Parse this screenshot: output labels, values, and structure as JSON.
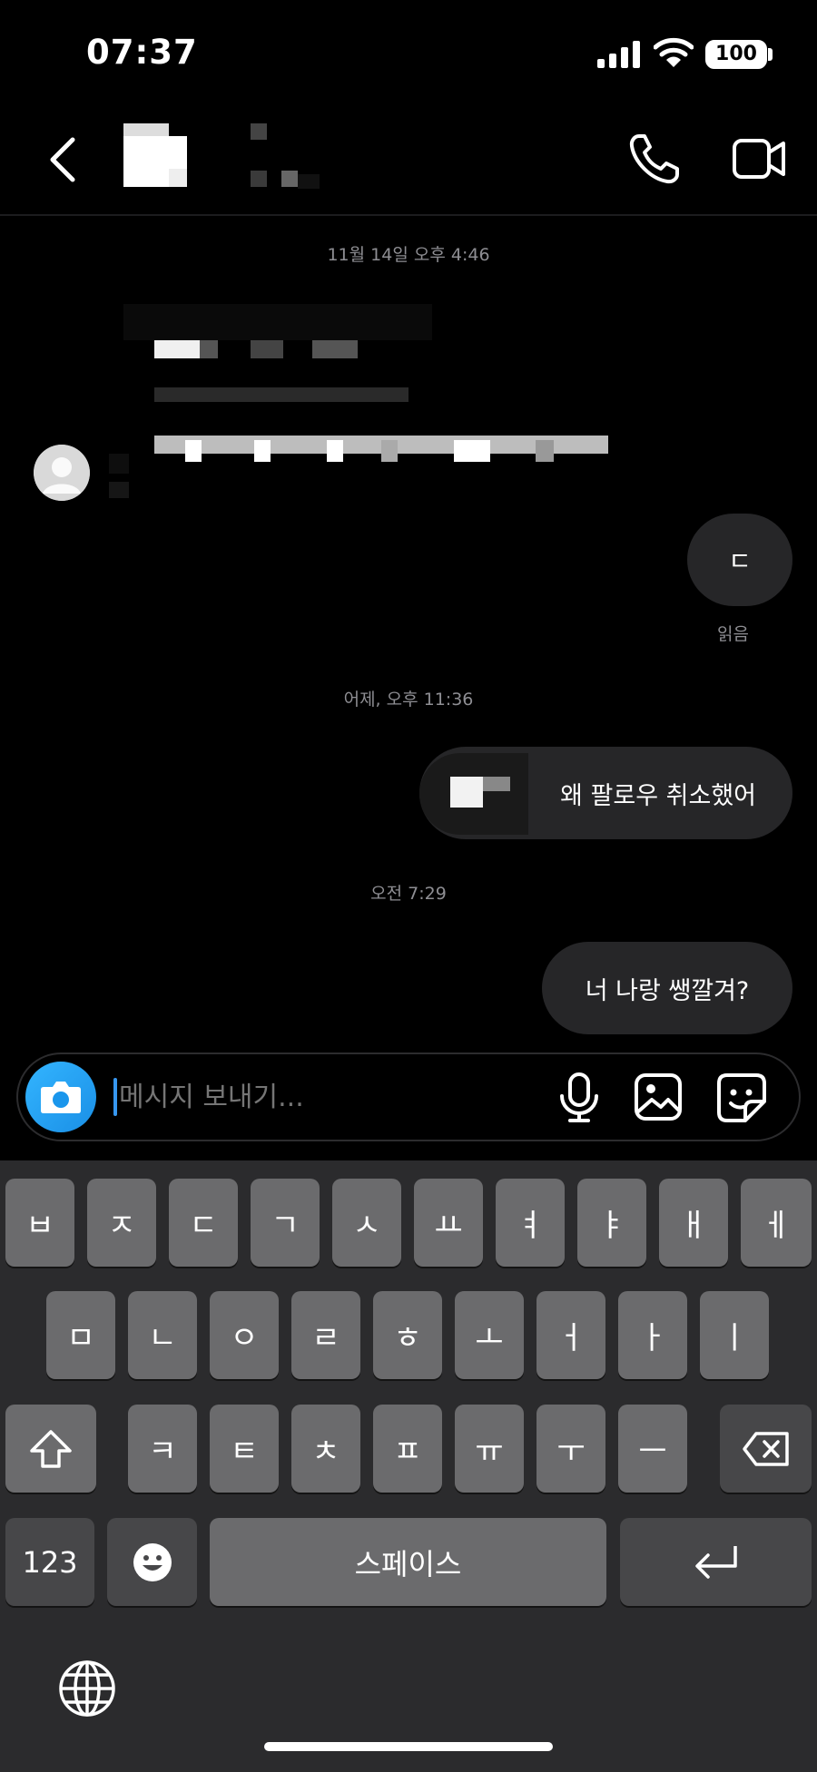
{
  "status_bar": {
    "time": "07:37",
    "battery": "100"
  },
  "timestamps": [
    "11월 14일 오후 4:46",
    "어제, 오후 11:36",
    "오전 7:29"
  ],
  "messages": {
    "outgoing_1": "ㄷ",
    "read_receipt": "읽음",
    "outgoing_2": "왜 팔로우 취소했어",
    "outgoing_3": "너 나랑 쌩깔겨?"
  },
  "composer": {
    "placeholder": "메시지 보내기..."
  },
  "keyboard": {
    "row1": [
      "ㅂ",
      "ㅈ",
      "ㄷ",
      "ㄱ",
      "ㅅ",
      "ㅛ",
      "ㅕ",
      "ㅑ",
      "ㅐ",
      "ㅔ"
    ],
    "row2": [
      "ㅁ",
      "ㄴ",
      "ㅇ",
      "ㄹ",
      "ㅎ",
      "ㅗ",
      "ㅓ",
      "ㅏ",
      "ㅣ"
    ],
    "row3": [
      "ㅋ",
      "ㅌ",
      "ㅊ",
      "ㅍ",
      "ㅠ",
      "ㅜ",
      "ㅡ"
    ],
    "numbers": "123",
    "space": "스페이스"
  },
  "colors": {
    "accent": "#3797f0",
    "bubble": "#262628",
    "background": "#000000",
    "key": "#6b6b6d"
  },
  "icons": [
    "back-icon",
    "phone-icon",
    "video-icon",
    "camera-icon",
    "microphone-icon",
    "gallery-icon",
    "sticker-icon",
    "shift-icon",
    "delete-icon",
    "emoji-icon",
    "return-icon",
    "globe-icon"
  ]
}
